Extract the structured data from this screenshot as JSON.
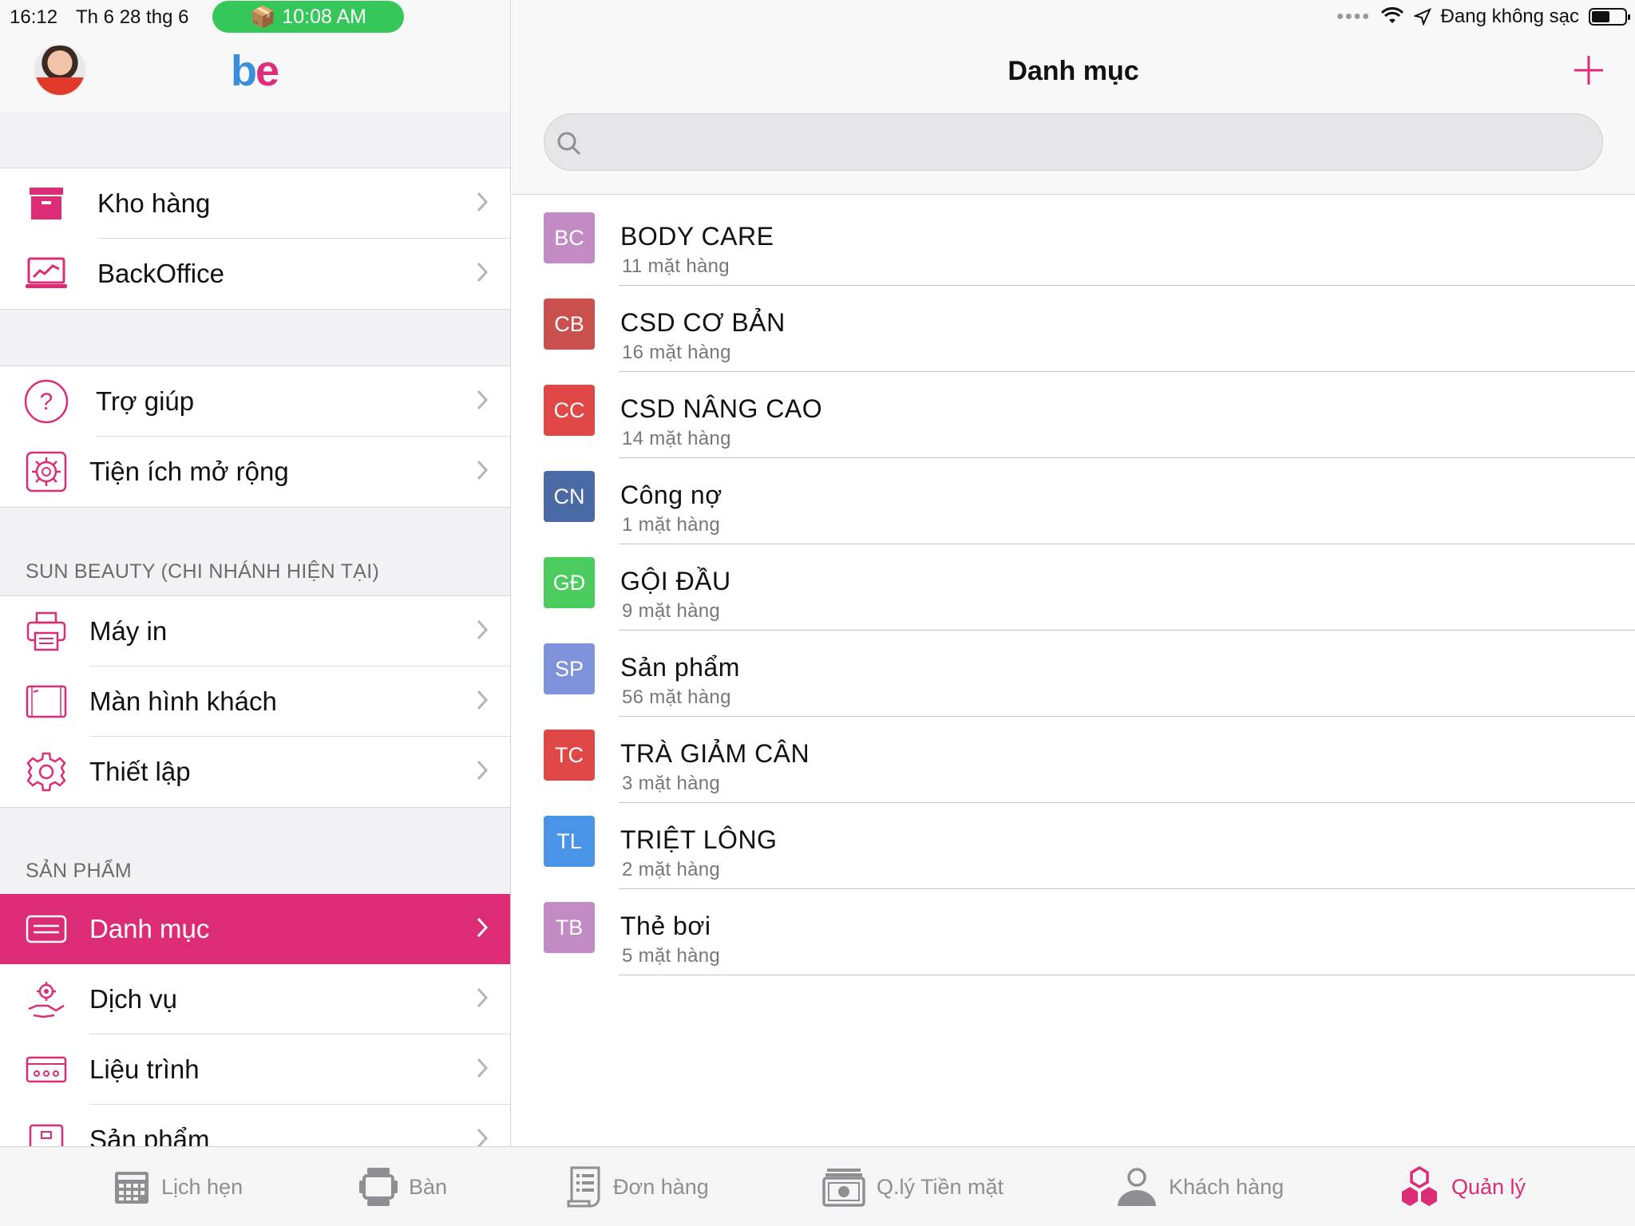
{
  "statusbar": {
    "time": "16:12",
    "date": "Th 6 28 thg 6",
    "pill_time": "10:08 AM",
    "charging": "Đang không sạc"
  },
  "app": {
    "logo_b": "b",
    "logo_e": "e",
    "brand_colors": {
      "accent": "#dd2c76",
      "logo_blue": "#3b8ed8"
    }
  },
  "sidebar": {
    "group1": [
      {
        "label": "Kho hàng",
        "icon": "archive-box-icon"
      },
      {
        "label": "BackOffice",
        "icon": "laptop-chart-icon"
      }
    ],
    "group2": [
      {
        "label": "Trợ giúp",
        "icon": "help-circle-icon"
      },
      {
        "label": "Tiện ích mở rộng",
        "icon": "extension-gear-icon"
      }
    ],
    "branch_title": "SUN BEAUTY (CHI NHÁNH HIỆN TẠI)",
    "group3": [
      {
        "label": "Máy in",
        "icon": "printer-icon"
      },
      {
        "label": "Màn hình khách",
        "icon": "customer-display-icon"
      },
      {
        "label": "Thiết lập",
        "icon": "settings-gear-icon"
      }
    ],
    "products_title": "SẢN PHẨM",
    "group4": [
      {
        "label": "Danh mục",
        "icon": "category-list-icon",
        "active": true
      },
      {
        "label": "Dịch vụ",
        "icon": "service-hand-icon"
      },
      {
        "label": "Liệu trình",
        "icon": "treatment-card-icon"
      },
      {
        "label": "Sản phẩm",
        "icon": "product-box-icon"
      }
    ]
  },
  "main": {
    "title": "Danh mục",
    "search_placeholder": "",
    "categories": [
      {
        "initials": "BC",
        "name": "BODY CARE",
        "count": "11 mặt hàng",
        "color": "#c38bc3"
      },
      {
        "initials": "CB",
        "name": "CSD CƠ BẢN",
        "count": "16 mặt hàng",
        "color": "#c9504f"
      },
      {
        "initials": "CC",
        "name": "CSD NÂNG CAO",
        "count": "14 mặt hàng",
        "color": "#e04848"
      },
      {
        "initials": "CN",
        "name": "Công nợ",
        "count": "1 mặt hàng",
        "color": "#4a6aa6"
      },
      {
        "initials": "GĐ",
        "name": "GỘI ĐẦU",
        "count": "9 mặt hàng",
        "color": "#4ccb5e"
      },
      {
        "initials": "SP",
        "name": "Sản phẩm",
        "count": "56 mặt hàng",
        "color": "#7f93dd"
      },
      {
        "initials": "TC",
        "name": "TRÀ GIẢM CÂN",
        "count": "3 mặt hàng",
        "color": "#e04848"
      },
      {
        "initials": "TL",
        "name": "TRIỆT LÔNG",
        "count": "2 mặt hàng",
        "color": "#4a94e8"
      },
      {
        "initials": "TB",
        "name": "Thẻ bơi",
        "count": "5 mặt hàng",
        "color": "#c38bc3"
      }
    ]
  },
  "tabbar": {
    "tabs": [
      {
        "label": "Lịch hẹn",
        "icon": "calendar-keypad-icon"
      },
      {
        "label": "Bàn",
        "icon": "table-icon"
      },
      {
        "label": "Đơn hàng",
        "icon": "receipt-icon"
      },
      {
        "label": "Q.lý Tiền mặt",
        "icon": "cash-register-icon"
      },
      {
        "label": "Khách hàng",
        "icon": "person-icon"
      },
      {
        "label": "Quản lý",
        "icon": "hexagons-icon",
        "active": true
      }
    ]
  }
}
